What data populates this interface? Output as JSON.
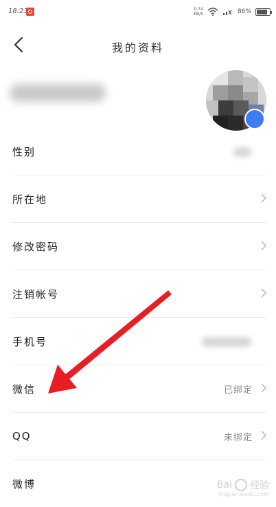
{
  "status": {
    "time": "18:23",
    "net_speed": "0.74\nKB/S",
    "battery": "86%"
  },
  "header": {
    "title": "我的资料"
  },
  "rows": [
    {
      "label": "性别"
    },
    {
      "label": "所在地"
    },
    {
      "label": "修改密码"
    },
    {
      "label": "注销帐号"
    },
    {
      "label": "手机号"
    },
    {
      "label": "微信",
      "value": "已绑定"
    },
    {
      "label": "QQ",
      "value": "未绑定"
    },
    {
      "label": "微博"
    }
  ],
  "watermark": {
    "brand": "Bai",
    "suffix": "经验",
    "sub": "jingyan.baidu.com"
  },
  "colors": {
    "arrow": "#e81e25",
    "badge": "#3b7cf0"
  }
}
